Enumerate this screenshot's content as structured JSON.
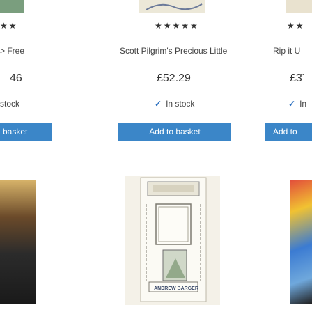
{
  "products": [
    {
      "rating_text": "★★",
      "availability_label": "Free",
      "price": "46",
      "stock_text": "stock",
      "button_label": "basket",
      "cover_icon": "book-cover-dark"
    },
    {
      "rating_text": "★★★★★",
      "title": "Scott Pilgrim's Precious Little",
      "price": "£52.29",
      "stock_text": "In stock",
      "button_label": "Add to basket",
      "cover_text": "ANDREW BARGER",
      "cover_icon": "book-cover-illustrated"
    },
    {
      "rating_text": "★★",
      "title": "Rip it U",
      "price": "£3̈",
      "stock_text": "In",
      "button_label": "Add to",
      "cover_icon": "book-cover-comic"
    }
  ],
  "colors": {
    "button_bg": "#3b86c8",
    "button_text": "#ffffff",
    "tick": "#2a6fbf"
  }
}
